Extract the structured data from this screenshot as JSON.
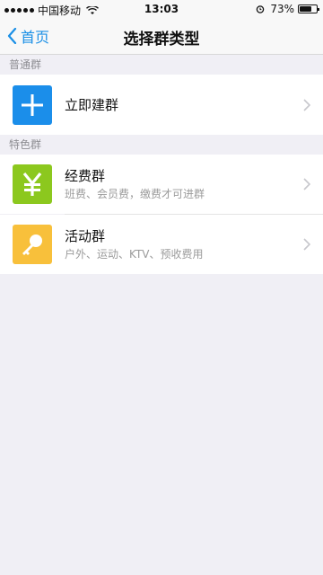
{
  "status_bar": {
    "carrier": "中国移动",
    "time": "13:03",
    "battery": "73%",
    "battery_level": 0.73
  },
  "nav": {
    "back_label": "首页",
    "title": "选择群类型"
  },
  "sections": {
    "normal": {
      "label": "普通群",
      "items": [
        {
          "title": "立即建群",
          "icon": "plus-icon",
          "icon_color": "#1b8eea"
        }
      ]
    },
    "featured": {
      "label": "特色群",
      "items": [
        {
          "title": "经费群",
          "subtitle": "班费、会员费，缴费才可进群",
          "icon": "yen-icon",
          "icon_color": "#8cc81e"
        },
        {
          "title": "活动群",
          "subtitle": "户外、运动、KTV、预收费用",
          "icon": "key-icon",
          "icon_color": "#f8c03b"
        }
      ]
    }
  },
  "colors": {
    "accent": "#1a8fe6",
    "background": "#f0eff5"
  }
}
